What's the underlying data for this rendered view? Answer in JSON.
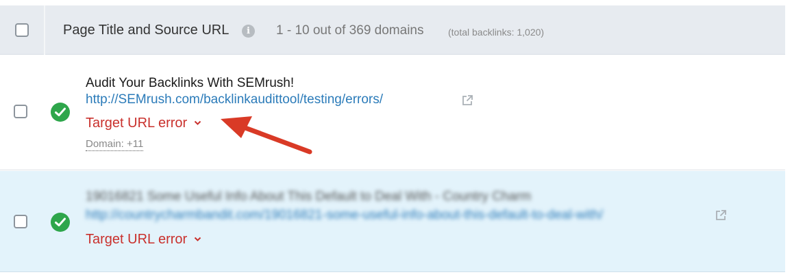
{
  "header": {
    "column_title": "Page Title and Source URL",
    "info_icon": "info-icon",
    "count_text": "1 - 10 out of 369 domains",
    "total_text": "(total backlinks: 1,020)"
  },
  "rows": [
    {
      "page_title": "Audit Your Backlinks With SEMrush!",
      "source_url": "http://SEMrush.com/backlinkaudittool/testing/errors/",
      "status": "ok",
      "target_error_label": "Target URL error",
      "domain_label": "Domain: +11"
    },
    {
      "page_title": "19016821 Some Useful Info About This Default to Deal With - Country Charm",
      "source_url": "http://countrycharmbandit.com/19016821-some-useful-info-about-this-default-to-deal-with/",
      "status": "ok",
      "target_error_label": "Target URL error"
    }
  ],
  "colors": {
    "header_bg": "#e7ebf0",
    "highlight_row_bg": "#e3f3fb",
    "link": "#2b7bb9",
    "error": "#c9302c",
    "status_ok": "#2ea64b",
    "annotation_arrow": "#d93a26"
  },
  "icons": {
    "status": "check-circle-icon",
    "external": "external-link-icon",
    "expand": "chevron-down-icon"
  }
}
